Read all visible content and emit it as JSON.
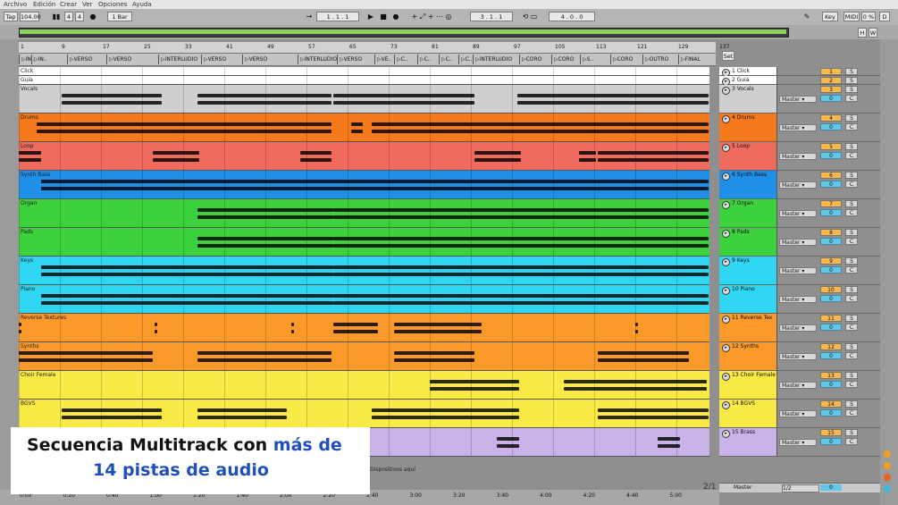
{
  "menu": [
    "Archivo",
    "Edición",
    "Crear",
    "Ver",
    "Opciones",
    "Ayuda"
  ],
  "transport": {
    "tap": "Tap",
    "tempo": "104.00",
    "time_sig_num": "4",
    "time_sig_den": "4",
    "quantize": "1 Bar",
    "position": "1 . 1 . 1",
    "loop_start": "3 . 1 . 1",
    "loop_length": "4 . 0 . 0",
    "key": "Key",
    "midi": "MIDI",
    "cpu": "0 %",
    "d": "D"
  },
  "overview": {
    "h": "H",
    "w": "W"
  },
  "ruler_bars": [
    "1",
    "9",
    "17",
    "25",
    "33",
    "41",
    "49",
    "57",
    "65",
    "73",
    "81",
    "89",
    "97",
    "105",
    "113",
    "121",
    "129",
    "137"
  ],
  "locators": [
    "IN..",
    "IN..",
    "VERSO",
    "VERSO",
    "INTERLUDIO",
    "VERSO",
    "VERSO",
    "INTERLUDIO",
    "VERSO",
    "VE..",
    "C..",
    "C..",
    "C..",
    "C..",
    "INTERLUDIO",
    "CORO",
    "CORO",
    "S..",
    "CORO",
    "OUTRO",
    "FINAL"
  ],
  "set_label": "Set",
  "tracks": [
    {
      "name": "Click",
      "num": "1",
      "mix": "1 Click",
      "color": "#ffffff",
      "h": 10
    },
    {
      "name": "Guia",
      "num": "2",
      "mix": "2 Guia",
      "color": "#ffffff",
      "h": 10
    },
    {
      "name": "Vocals",
      "num": "3",
      "mix": "3 Vocals",
      "color": "#cfcfcf",
      "h": 32
    },
    {
      "name": "Drums",
      "num": "4",
      "mix": "4 Drums",
      "color": "#f6791b",
      "h": 32
    },
    {
      "name": "Loop",
      "num": "5",
      "mix": "5 Loop",
      "color": "#ee6b5e",
      "h": 32
    },
    {
      "name": "Synth Bass",
      "num": "6",
      "mix": "6 Synth Bass",
      "color": "#1f8fe8",
      "h": 32
    },
    {
      "name": "Organ",
      "num": "7",
      "mix": "7 Organ",
      "color": "#3dd13d",
      "h": 32
    },
    {
      "name": "Pads",
      "num": "8",
      "mix": "8 Pads",
      "color": "#3dd13d",
      "h": 32
    },
    {
      "name": "Keys",
      "num": "9",
      "mix": "9 Keys",
      "color": "#2fd7f2",
      "h": 32
    },
    {
      "name": "Piano",
      "num": "10",
      "mix": "10 Piano",
      "color": "#2fd7f2",
      "h": 32
    },
    {
      "name": "Reverse Textures",
      "num": "11",
      "mix": "11 Reverse Tex",
      "color": "#fb9a2b",
      "h": 32
    },
    {
      "name": "Synths",
      "num": "12",
      "mix": "12 Synths",
      "color": "#fb9a2b",
      "h": 32
    },
    {
      "name": "Choir Female",
      "num": "13",
      "mix": "13 Choir Female",
      "color": "#f9ea45",
      "h": 32
    },
    {
      "name": "BGVS",
      "num": "14",
      "mix": "14 BGVS",
      "color": "#f9ea45",
      "h": 32
    },
    {
      "name": "Brass",
      "num": "15",
      "mix": "15 Brass",
      "color": "#c8b2e8",
      "h": 32
    }
  ],
  "mixer": {
    "routing": "Master",
    "zero": "0",
    "s": "S",
    "c": "C",
    "master_label": "Master",
    "master_routing": "1/2",
    "master_zero": "0"
  },
  "drop_hint": "Dispositivos aquí",
  "page_counter": "2/1",
  "timeline": [
    "0:00",
    "0:20",
    "0:40",
    "1:00",
    "1:20",
    "1:40",
    "2:00",
    "2:20",
    "2:40",
    "3:00",
    "3:20",
    "3:40",
    "4:00",
    "4:20",
    "4:40",
    "5:00"
  ],
  "banner": {
    "line1_a": "Secuencia Multitrack con ",
    "line1_b": "más de",
    "line2": "14 pistas de audio"
  }
}
